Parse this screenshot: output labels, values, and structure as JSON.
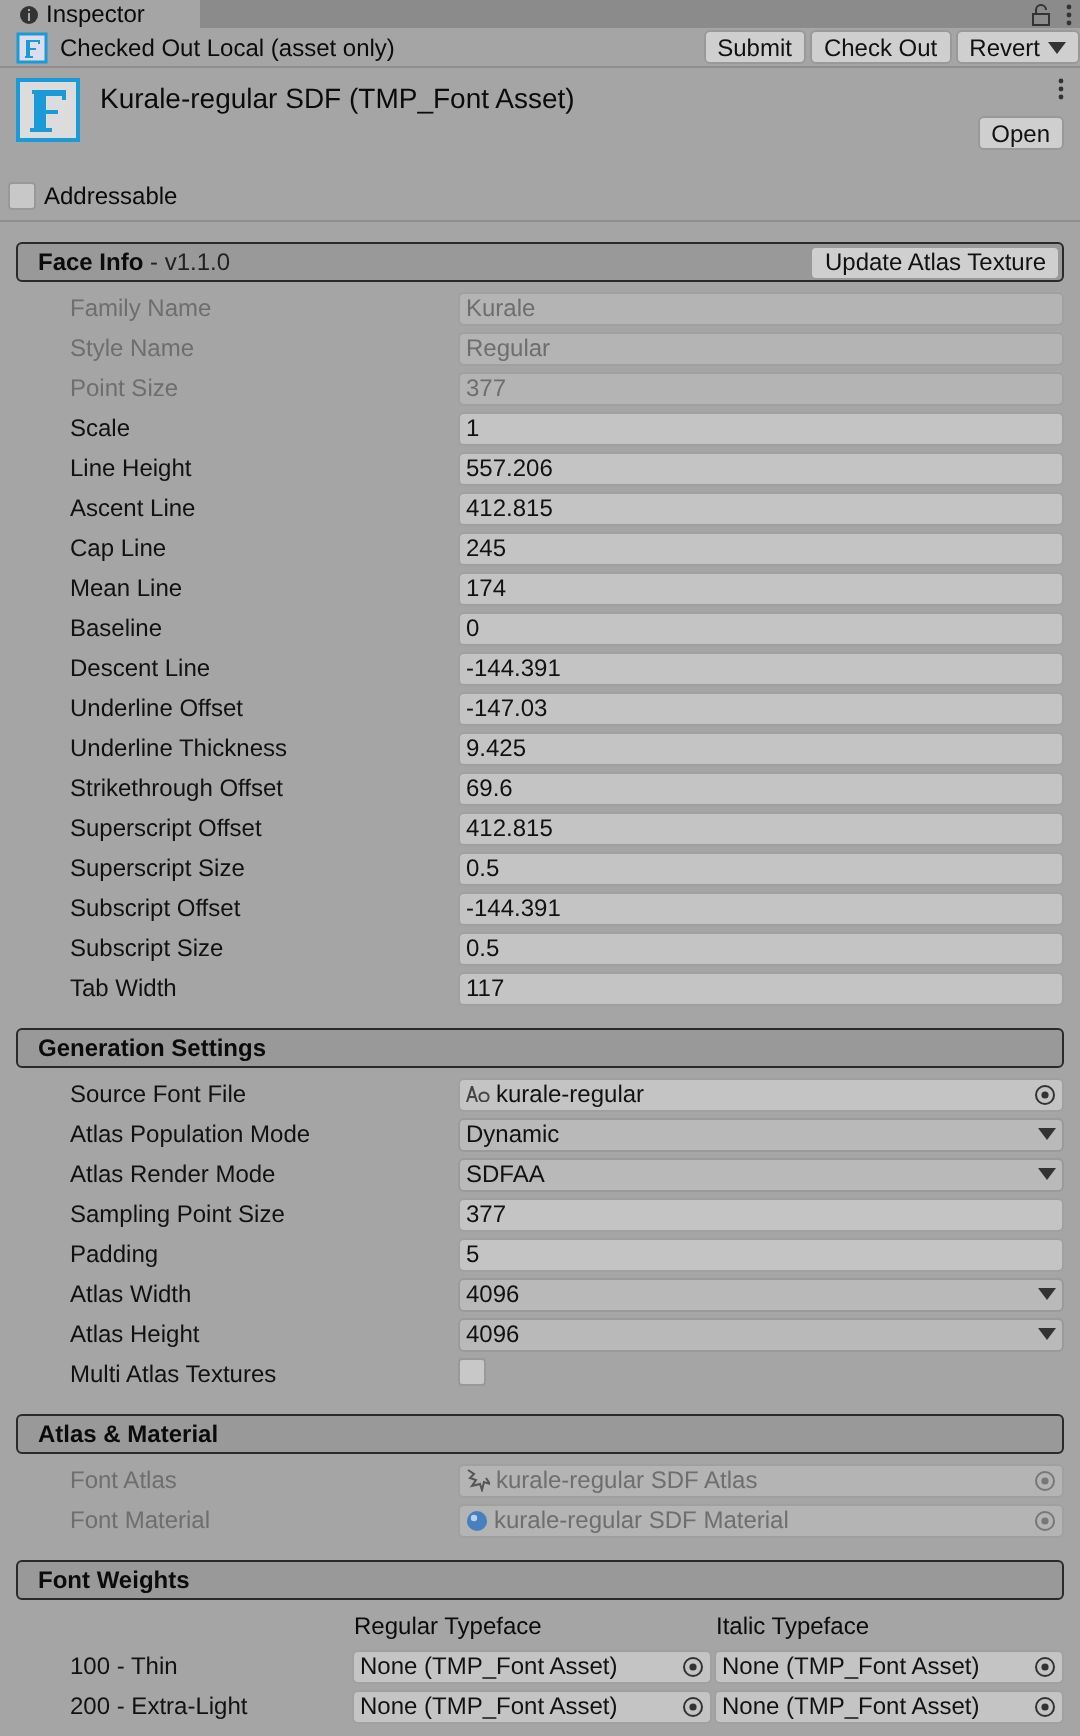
{
  "tab": {
    "label": "Inspector"
  },
  "version_control": {
    "status": "Checked Out Local (asset only)",
    "buttons": [
      "Submit",
      "Check Out",
      "Revert"
    ]
  },
  "asset": {
    "title": "Kurale-regular SDF (TMP_Font Asset)",
    "open_button": "Open"
  },
  "addressable": {
    "label": "Addressable",
    "checked": false
  },
  "sections": [
    {
      "title": "Face Info",
      "subtitle": "- v1.1.0",
      "action": "Update Atlas Texture",
      "fields": [
        {
          "label": "Family Name",
          "value": "Kurale",
          "kind": "text",
          "disabled": true
        },
        {
          "label": "Style Name",
          "value": "Regular",
          "kind": "text",
          "disabled": true
        },
        {
          "label": "Point Size",
          "value": "377",
          "kind": "text",
          "disabled": true
        },
        {
          "label": "Scale",
          "value": "1",
          "kind": "text",
          "disabled": false
        },
        {
          "label": "Line Height",
          "value": "557.206",
          "kind": "text",
          "disabled": false
        },
        {
          "label": "Ascent Line",
          "value": "412.815",
          "kind": "text",
          "disabled": false
        },
        {
          "label": "Cap Line",
          "value": "245",
          "kind": "text",
          "disabled": false
        },
        {
          "label": "Mean Line",
          "value": "174",
          "kind": "text",
          "disabled": false
        },
        {
          "label": "Baseline",
          "value": "0",
          "kind": "text",
          "disabled": false
        },
        {
          "label": "Descent Line",
          "value": "-144.391",
          "kind": "text",
          "disabled": false
        },
        {
          "label": "Underline Offset",
          "value": "-147.03",
          "kind": "text",
          "disabled": false
        },
        {
          "label": "Underline Thickness",
          "value": "9.425",
          "kind": "text",
          "disabled": false
        },
        {
          "label": "Strikethrough Offset",
          "value": "69.6",
          "kind": "text",
          "disabled": false
        },
        {
          "label": "Superscript Offset",
          "value": "412.815",
          "kind": "text",
          "disabled": false
        },
        {
          "label": "Superscript Size",
          "value": "0.5",
          "kind": "text",
          "disabled": false
        },
        {
          "label": "Subscript Offset",
          "value": "-144.391",
          "kind": "text",
          "disabled": false
        },
        {
          "label": "Subscript Size",
          "value": "0.5",
          "kind": "text",
          "disabled": false
        },
        {
          "label": "Tab Width",
          "value": "117",
          "kind": "text",
          "disabled": false
        }
      ]
    },
    {
      "title": "Generation Settings",
      "fields": [
        {
          "label": "Source Font File",
          "value": "kurale-regular",
          "kind": "object",
          "disabled": false
        },
        {
          "label": "Atlas Population Mode",
          "value": "Dynamic",
          "kind": "dropdown",
          "disabled": false
        },
        {
          "label": "Atlas Render Mode",
          "value": "SDFAA",
          "kind": "dropdown",
          "disabled": false
        },
        {
          "label": "Sampling Point Size",
          "value": "377",
          "kind": "text",
          "disabled": false
        },
        {
          "label": "Padding",
          "value": "5",
          "kind": "text",
          "disabled": false
        },
        {
          "label": "Atlas Width",
          "value": "4096",
          "kind": "dropdown",
          "disabled": false
        },
        {
          "label": "Atlas Height",
          "value": "4096",
          "kind": "dropdown",
          "disabled": false
        },
        {
          "label": "Multi Atlas Textures",
          "kind": "checkbox",
          "checked": false,
          "disabled": false
        }
      ]
    },
    {
      "title": "Atlas & Material",
      "fields": [
        {
          "label": "Font Atlas",
          "value": "kurale-regular SDF Atlas",
          "kind": "object",
          "disabled": true
        },
        {
          "label": "Font Material",
          "value": "kurale-regular SDF Material",
          "kind": "object",
          "disabled": true
        }
      ]
    },
    {
      "title": "Font Weights",
      "weights": {
        "columns": [
          "Regular Typeface",
          "Italic Typeface"
        ],
        "rows": [
          {
            "label": "100 - Thin",
            "regular": "None (TMP_Font Asset)",
            "italic": "None (TMP_Font Asset)"
          },
          {
            "label": "200 - Extra-Light",
            "regular": "None (TMP_Font Asset)",
            "italic": "None (TMP_Font Asset)"
          }
        ]
      }
    }
  ]
}
